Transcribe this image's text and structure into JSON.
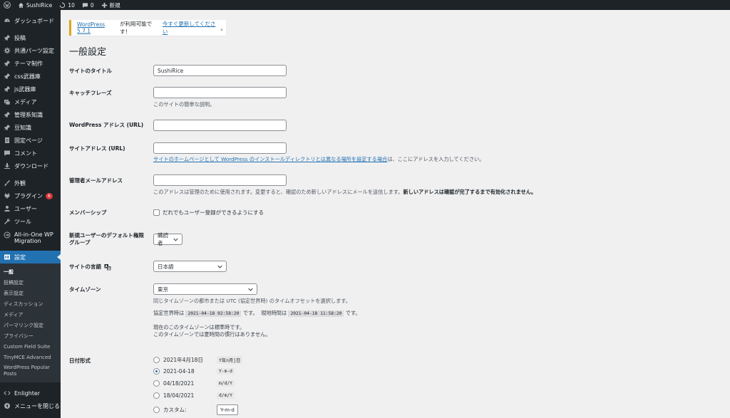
{
  "adminbar": {
    "site_name": "SushiRice",
    "updates_count": "10",
    "comments_count": "0",
    "new_label": "新規"
  },
  "sidebar": {
    "dashboard": "ダッシュボード",
    "items": [
      {
        "label": "投稿",
        "icon": "pin-icon"
      },
      {
        "label": "共通パーツ設定",
        "icon": "gear-icon"
      },
      {
        "label": "テーマ制作",
        "icon": "pin-icon"
      },
      {
        "label": "css武器庫",
        "icon": "pin-icon"
      },
      {
        "label": "js武器庫",
        "icon": "pin-icon"
      },
      {
        "label": "メディア",
        "icon": "media-icon"
      },
      {
        "label": "管理系知識",
        "icon": "pin-icon"
      },
      {
        "label": "豆知識",
        "icon": "pin-icon"
      },
      {
        "label": "固定ページ",
        "icon": "page-icon"
      },
      {
        "label": "コメント",
        "icon": "comment-icon"
      },
      {
        "label": "ダウンロード",
        "icon": "download-icon"
      }
    ],
    "items2": [
      {
        "label": "外観",
        "icon": "brush-icon"
      },
      {
        "label": "プラグイン",
        "icon": "plugin-icon",
        "badge": "6"
      },
      {
        "label": "ユーザー",
        "icon": "user-icon"
      },
      {
        "label": "ツール",
        "icon": "wrench-icon"
      },
      {
        "label": "All-in-One WP Migration",
        "icon": "migration-icon"
      }
    ],
    "settings": "設定",
    "submenu": [
      "一般",
      "投稿設定",
      "表示設定",
      "ディスカッション",
      "メディア",
      "パーマリンク設定",
      "プライバシー",
      "Custom Field Suite",
      "TinyMCE Advanced",
      "WordPress Popular Posts"
    ],
    "enlighter": "Enlighter",
    "collapse": "メニューを閉じる"
  },
  "notice": {
    "version_link": "WordPress 5.7.1",
    "text": " が利用可能です！",
    "update_link": "今すぐ更新してください",
    "end": "。"
  },
  "page_title": "一般設定",
  "fields": {
    "site_title": {
      "label": "サイトのタイトル",
      "value": "SushiRice"
    },
    "tagline": {
      "label": "キャッチフレーズ",
      "value": "",
      "desc": "このサイトの簡単な説明。"
    },
    "wp_address": {
      "label": "WordPress アドレス (URL)",
      "value": ""
    },
    "site_address": {
      "label": "サイトアドレス (URL)",
      "value": "",
      "desc_link": "サイトのホームページとして WordPress のインストールディレクトリとは異なる場所を設定する場合",
      "desc_rest": "は、ここにアドレスを入力してください。"
    },
    "admin_email": {
      "label": "管理者メールアドレス",
      "value": "",
      "desc": "このアドレスは管理のために使用されます。変更すると、確認のため新しいアドレスにメールを送信します。",
      "desc_bold": "新しいアドレスは確認が完了するまで有効化されません。"
    },
    "membership": {
      "label": "メンバーシップ",
      "checkbox": "だれでもユーザー登録ができるようにする"
    },
    "default_role": {
      "label": "新規ユーザーのデフォルト権限グループ",
      "value": "購読者"
    },
    "language": {
      "label": "サイトの言語",
      "value": "日本語"
    },
    "timezone": {
      "label": "タイムゾーン",
      "value": "東京",
      "desc": "同じタイムゾーンの都市または UTC (協定世界時) のタイムオフセットを選択します。",
      "utc_label": "協定世界時は",
      "utc_time": "2021-04-18 02:58:20",
      "utc_suffix": "です。",
      "local_label": "現地時間は",
      "local_time": "2021-04-18 11:58:20",
      "local_suffix": "です。",
      "std_line1": "現在のこのタイムゾーンは標準時です。",
      "std_line2": "このタイムゾーンでは夏時間の慣行はありません。"
    },
    "date_format": {
      "label": "日付形式",
      "options": [
        {
          "label": "2021年4月18日",
          "code": "Y年n月j日",
          "checked": false
        },
        {
          "label": "2021-04-18",
          "code": "Y-m-d",
          "checked": true
        },
        {
          "label": "04/18/2021",
          "code": "m/d/Y",
          "checked": false
        },
        {
          "label": "18/04/2021",
          "code": "d/m/Y",
          "checked": false
        }
      ],
      "custom_label": "カスタム:",
      "custom_value": "Y-m-d"
    }
  }
}
